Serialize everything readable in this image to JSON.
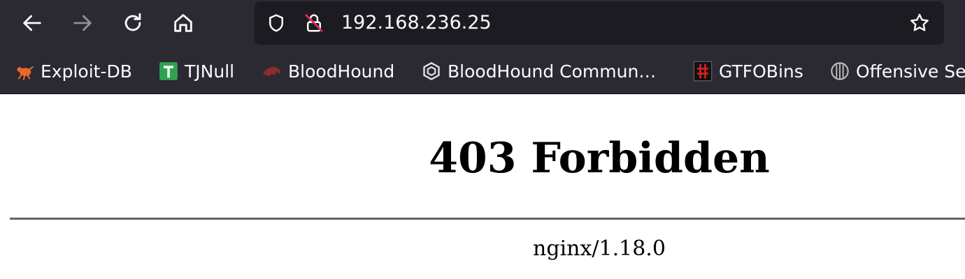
{
  "toolbar": {
    "back_icon": "arrow-left-icon",
    "forward_icon": "arrow-right-icon",
    "reload_icon": "reload-icon",
    "home_icon": "home-icon",
    "colors": {
      "chrome_bg": "#2b2a33",
      "urlbar_bg": "#1c1b22",
      "icon": "#fbfbfe",
      "icon_disabled": "#8f8f9d",
      "insecure_slash": "#e22850"
    }
  },
  "urlbar": {
    "url": "192.168.236.25",
    "shield_icon": "shield-icon",
    "insecure_lock_icon": "insecure-lock-icon",
    "star_icon": "star-icon"
  },
  "bookmarks": [
    {
      "label": "Exploit-DB",
      "icon": "exploit-db-icon"
    },
    {
      "label": "TJNull",
      "icon": "tjnull-icon"
    },
    {
      "label": "BloodHound",
      "icon": "bloodhound-icon"
    },
    {
      "label": "BloodHound Commun…",
      "icon": "bloodhound-community-icon"
    },
    {
      "label": "GTFOBins",
      "icon": "gtfobins-icon"
    },
    {
      "label": "Offensive Se",
      "icon": "offensive-security-icon"
    }
  ],
  "page": {
    "title": "403 Forbidden",
    "server": "nginx/1.18.0"
  }
}
